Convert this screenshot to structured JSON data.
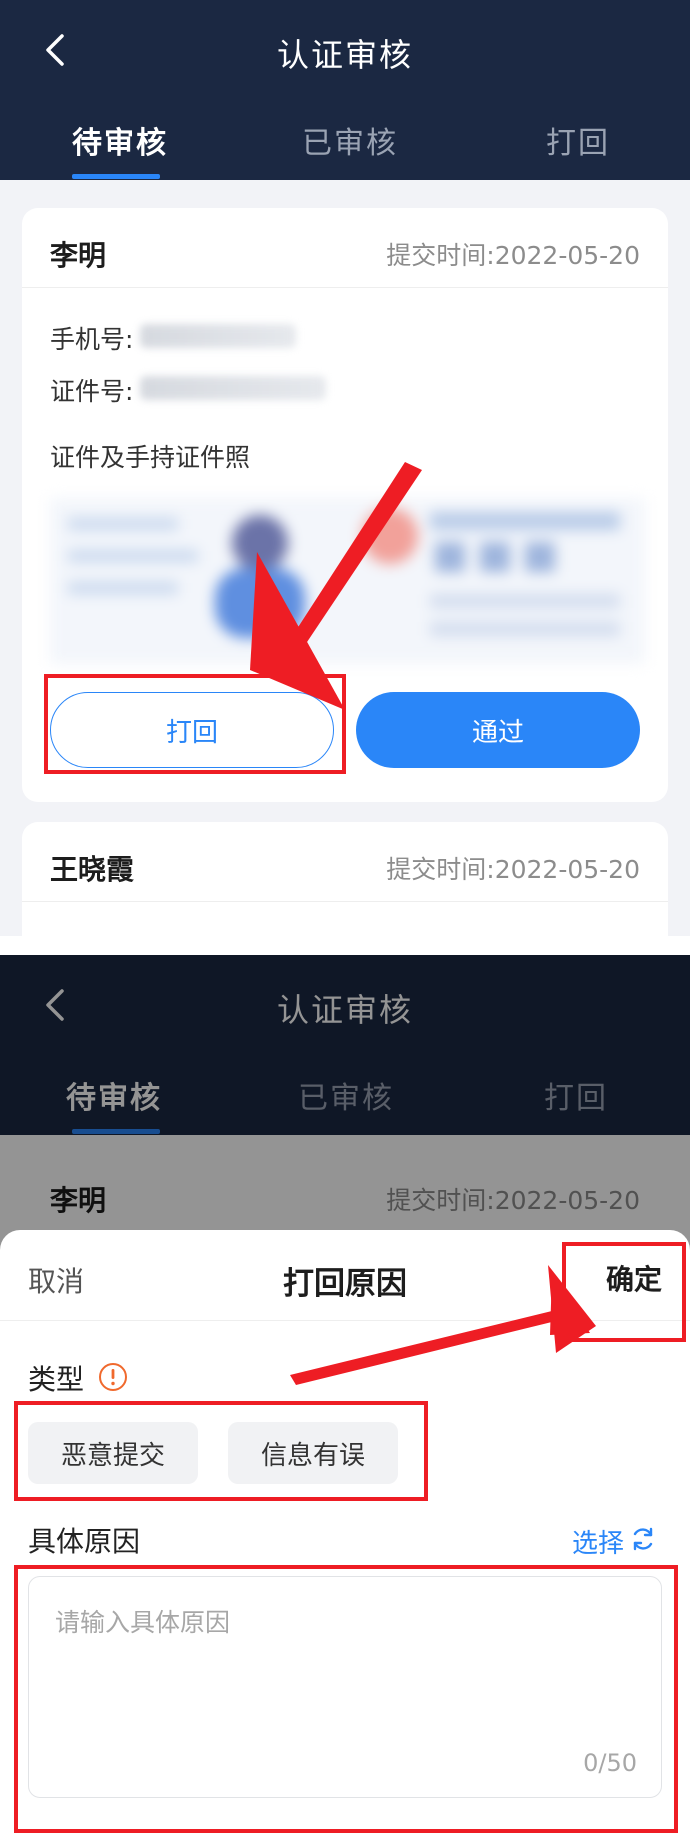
{
  "top": {
    "nav": {
      "title": "认证审核"
    },
    "tabs": [
      {
        "label": "待审核",
        "active": true
      },
      {
        "label": "已审核",
        "active": false
      },
      {
        "label": "打回",
        "active": false
      }
    ],
    "cards": [
      {
        "name": "李明",
        "submit_time": "提交时间:2022-05-20",
        "phone_label": "手机号:",
        "id_label": "证件号:",
        "photo_label": "证件及手持证件照",
        "reject_label": "打回",
        "approve_label": "通过"
      },
      {
        "name": "王晓霞",
        "submit_time": "提交时间:2022-05-20"
      }
    ]
  },
  "bottom": {
    "nav": {
      "title": "认证审核"
    },
    "tabs": [
      {
        "label": "待审核",
        "active": true
      },
      {
        "label": "已审核",
        "active": false
      },
      {
        "label": "打回",
        "active": false
      }
    ],
    "card": {
      "name": "李明",
      "submit_time": "提交时间:2022-05-20"
    },
    "sheet": {
      "cancel_label": "取消",
      "title": "打回原因",
      "confirm_label": "确定",
      "type_label": "类型",
      "types": [
        "恶意提交",
        "信息有误"
      ],
      "reason_label": "具体原因",
      "select_label": "选择",
      "placeholder": "请输入具体原因",
      "counter": "0/50"
    }
  },
  "colors": {
    "nav_bg": "#1b2842",
    "accent": "#2a86f8",
    "highlight": "#ee1d24",
    "warning": "#f0692d"
  }
}
